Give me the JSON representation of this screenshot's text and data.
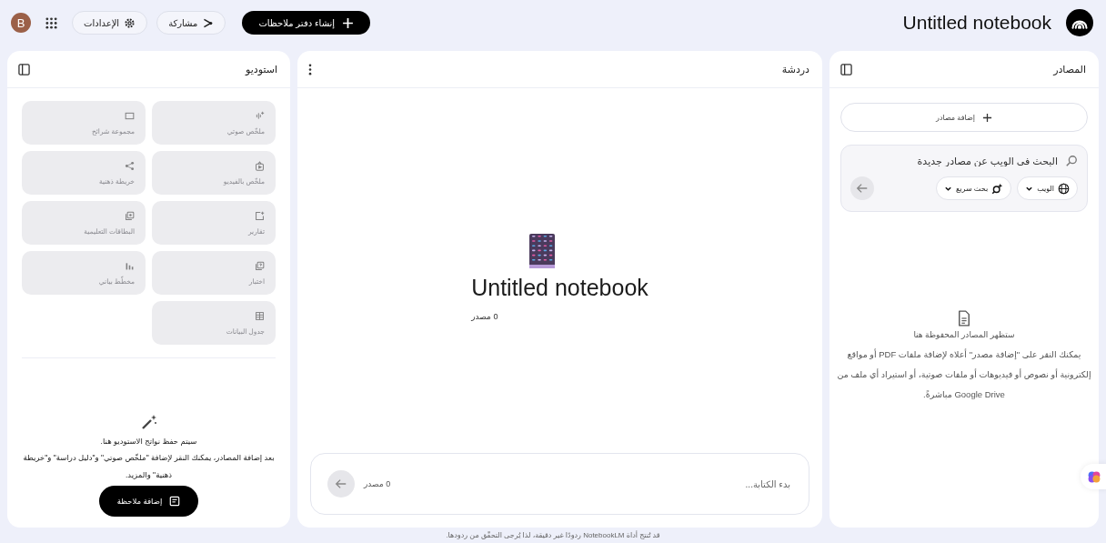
{
  "header": {
    "title": "Untitled notebook",
    "create_button": "إنشاء دفتر ملاحظات",
    "share_button": "مشاركة",
    "settings_button": "الإعدادات",
    "avatar": "B"
  },
  "sources": {
    "title": "المصادر",
    "add_button": "إضافة مصادر",
    "search": {
      "placeholder": "البحث في الويب عن مصادر جديدة"
    },
    "chips": [
      {
        "label": "الويب"
      },
      {
        "label": "بحث سريع"
      }
    ],
    "submit_disabled": true,
    "empty_title": "ستظهر المصادر المحفوظة هنا",
    "empty_text": "يمكنك النقر على \"إضافة مصدر\" أعلاه لإضافة ملفات PDF أو مواقع إلكترونية أو نصوص أو فيديوهات أو ملفات صوتية، أو استيراد أي ملف من Google Drive مباشرةً."
  },
  "chat": {
    "title": "دردشة",
    "notebook_title": "Untitled notebook",
    "source_count": "0 مصدر",
    "input": {
      "placeholder": "بدء الكتابة..."
    },
    "input_count": "0 مصدر",
    "send_disabled": true
  },
  "studio": {
    "title": "استوديو",
    "tiles": [
      {
        "label": "ملخّص صوتي",
        "disabled": true
      },
      {
        "label": "مجموعة شرائح",
        "disabled": true
      },
      {
        "label": "ملخّص بالفيديو",
        "disabled": true
      },
      {
        "label": "خريطة ذهنية",
        "disabled": true
      },
      {
        "label": "تقارير",
        "disabled": true
      },
      {
        "label": "البطاقات التعليمية",
        "disabled": true
      },
      {
        "label": "اختبار",
        "disabled": true
      },
      {
        "label": "مخطّط بياني",
        "disabled": true
      },
      {
        "label": "جدول البيانات",
        "disabled": true
      }
    ],
    "empty_title": "سيتم حفظ نواتج الاستوديو هنا.",
    "empty_text": "بعد إضافة المصادر، يمكنك النقر لإضافة \"ملخّص صوتي\" و\"دليل دراسة\" و\"خريطة ذهنية\" والمزيد.",
    "note_button": "إضافة ملاحظة"
  },
  "footer": "قد تُنتج أداة NotebookLM ردودًا غير دقيقة، لذا يُرجى التحقّق من ردودها."
}
